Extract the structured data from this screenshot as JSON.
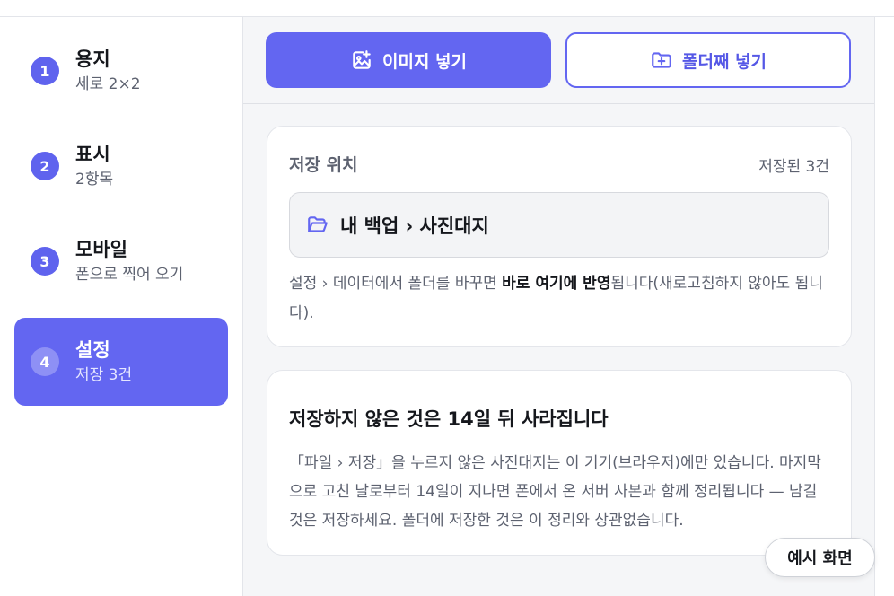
{
  "sidebar": {
    "steps": [
      {
        "num": "1",
        "title": "용지",
        "sub": "세로 2×2"
      },
      {
        "num": "2",
        "title": "표시",
        "sub": "2항목"
      },
      {
        "num": "3",
        "title": "모바일",
        "sub": "폰으로 찍어 오기"
      },
      {
        "num": "4",
        "title": "설정",
        "sub": "저장 3건"
      }
    ],
    "active_step": "4"
  },
  "actions": {
    "insert_image": "이미지 넣기",
    "insert_folder": "폴더째 넣기"
  },
  "storage": {
    "label": "저장 위치",
    "count": "저장된 3건",
    "path": "내 백업 › 사진대지",
    "note_prefix": "설정 › 데이터에서 폴더를 바꾸면 ",
    "note_bold": "바로 여기에 반영",
    "note_suffix": "됩니다(새로고침하지 않아도 됩니다)."
  },
  "retention": {
    "heading": "저장하지 않은 것은 14일 뒤 사라집니다",
    "body": "「파일 › 저장」을 누르지 않은 사진대지는 이 기기(브라우저)에만 있습니다. 마지막으로 고친 날로부터 14일이 지나면 폰에서 온 서버 사본과 함께 정리됩니다 — 남길 것은 저장하세요. 폴더에 저장한 것은 이 정리와 상관없습니다."
  },
  "example_badge": "예시 화면",
  "colors": {
    "accent": "#6366f1",
    "text_dark": "#15171c",
    "text_muted": "#5d6270"
  },
  "icons": {
    "insert_image": "image-plus-icon",
    "insert_folder": "folder-plus-icon",
    "path": "folder-open-icon"
  }
}
